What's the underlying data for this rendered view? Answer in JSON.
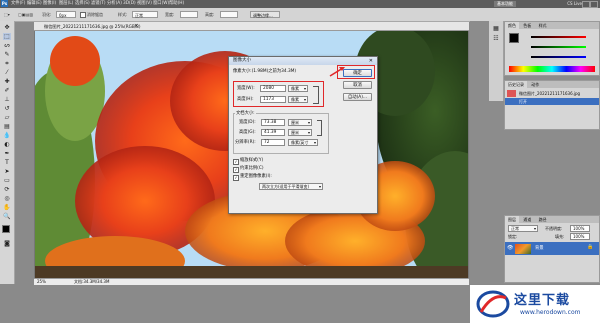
{
  "app": {
    "logo": "Ps"
  },
  "menubar": {
    "items": [
      "文件(F)",
      "编辑(E)",
      "图像(I)",
      "图层(L)",
      "选择(S)",
      "滤镜(T)",
      "分析(A)",
      "3D(D)",
      "视图(V)",
      "窗口(W)",
      "帮助(H)"
    ],
    "workspace": "基本功能",
    "cs_live": "CS Live"
  },
  "optbar": {
    "feather_label": "羽化:",
    "feather_value": "0px",
    "antialias_label": "消除锯齿",
    "style_label": "样式:",
    "style_value": "正常",
    "width_label": "宽度:",
    "height_label": "高度:",
    "refine_button": "调整边缘..."
  },
  "document": {
    "tab_title": "微信图片_20221211171636.jpg @ 25%(RGB/8)",
    "zoom": "25%",
    "doc_size": "文档:34.3M/34.3M"
  },
  "dialog": {
    "title": "图像大小",
    "pixel_dims": "像素大小:(1.98M(之前为34.3M)",
    "width_label": "宽度(W):",
    "width_value": "2080",
    "width_unit": "像素",
    "height_label": "高度(H):",
    "height_value": "1173",
    "height_unit": "像素",
    "doc_size_label": "文档大小:",
    "doc_width_label": "宽度(D):",
    "doc_width_value": "73.38",
    "doc_width_unit": "厘米",
    "doc_height_label": "高度(G):",
    "doc_height_value": "41.39",
    "doc_height_unit": "厘米",
    "res_label": "分辨率(R):",
    "res_value": "72",
    "res_unit": "像素/英寸",
    "scale_styles": "缩放样式(Y)",
    "constrain": "约束比例(C)",
    "resample": "重定图像像素(I):",
    "resample_method": "两次立方(适用于平滑渐变)",
    "ok": "确定",
    "cancel": "取消",
    "auto": "自动(A)..."
  },
  "panels": {
    "color_tabs": [
      "颜色",
      "色板",
      "样式"
    ],
    "history_tabs": [
      "历史记录",
      "动作"
    ],
    "history_snapshot": "微信图片_20221211171636.jpg",
    "history_item": "打开",
    "layers_tabs": [
      "图层",
      "通道",
      "路径"
    ],
    "blend_mode": "正常",
    "opacity_label": "不透明度:",
    "opacity_value": "100%",
    "lock_label": "锁定:",
    "fill_label": "填充:",
    "fill_value": "100%",
    "layer_name": "背景"
  },
  "watermark": {
    "brand": "这里下载",
    "url": "www.herodown.com"
  },
  "colors": {
    "accent_red": "#e0282a",
    "selection_blue": "#3b6fc0",
    "ps_blue": "#2a6fb6",
    "brand_blue": "#1b4aa0"
  }
}
